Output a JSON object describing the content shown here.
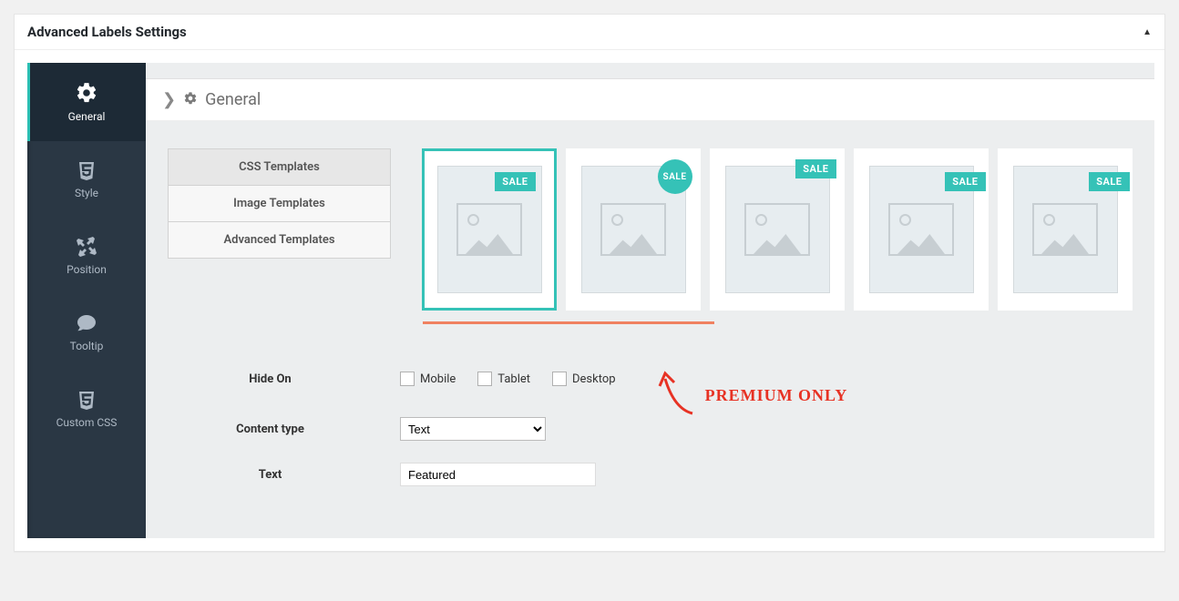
{
  "panel": {
    "title": "Advanced Labels Settings"
  },
  "sidebar": {
    "items": [
      {
        "label": "General"
      },
      {
        "label": "Style"
      },
      {
        "label": "Position"
      },
      {
        "label": "Tooltip"
      },
      {
        "label": "Custom CSS"
      }
    ]
  },
  "breadcrumb": {
    "current": "General"
  },
  "template_tabs": [
    {
      "label": "CSS Templates",
      "active": true
    },
    {
      "label": "Image Templates",
      "active": false
    },
    {
      "label": "Advanced Templates",
      "active": false
    }
  ],
  "previews": [
    {
      "badge_text": "SALE",
      "style": "rect-inside",
      "selected": true
    },
    {
      "badge_text": "SALE",
      "style": "circle-corner",
      "selected": false
    },
    {
      "badge_text": "SALE",
      "style": "rect-corner",
      "selected": false
    },
    {
      "badge_text": "SALE",
      "style": "rect-edge",
      "selected": false
    },
    {
      "badge_text": "SALE",
      "style": "rect-edge2",
      "selected": false
    }
  ],
  "form": {
    "hide_on": {
      "label": "Hide On",
      "options": [
        {
          "label": "Mobile"
        },
        {
          "label": "Tablet"
        },
        {
          "label": "Desktop"
        }
      ]
    },
    "content_type": {
      "label": "Content type",
      "value": "Text"
    },
    "text": {
      "label": "Text",
      "value": "Featured"
    }
  },
  "annotation": {
    "text": "PREMIUM ONLY"
  }
}
